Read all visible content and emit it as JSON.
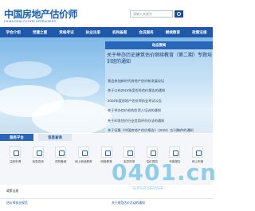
{
  "header": {
    "logo_cn": "中国房地产估价师",
    "logo_en": "CHINA REAL ESTATE APPRAISERS",
    "search_placeholder": "请输入关键字"
  },
  "nav": {
    "items": [
      "学会介绍",
      "党建之窗",
      "资格考试",
      "执业注册",
      "机构备案",
      "会员服务",
      "继续教育",
      "政策法规"
    ]
  },
  "news": {
    "title": "动态要闻",
    "lead": "关于举办历史建筑估价继续教育（第二期）专题培训班的通知",
    "items": [
      "我会参加新时代房地产估价新发展论坛",
      "关于公布2024年度优秀估价报告的通知",
      "2024年度房地产估价师执业考试公告",
      "关于举办估价机构负责人培训的通知",
      "关于印发估价行业信用评价办法的通知",
      "关于征集《中国房地产估价报告》（2024）在刊稿件的通知"
    ]
  },
  "services": {
    "tab_primary": "服务平台",
    "tab_secondary": "信息查询",
    "items": [
      "注册申请",
      "信息查询",
      "机构备案",
      "网上继续教育",
      "网络教育",
      "会员风采",
      "估价规范",
      "年度报告",
      "网上申报"
    ]
  },
  "bottom": {
    "tab_label": "政策法规",
    "items": [
      "估价师执业规范",
      "关于规范估价活动的通知"
    ]
  },
  "watermark": {
    "main": "0401.cn",
    "sub": "SUPER SERVER"
  },
  "colors": {
    "brand": "#1f58a8",
    "accent": "#2a66b8"
  }
}
